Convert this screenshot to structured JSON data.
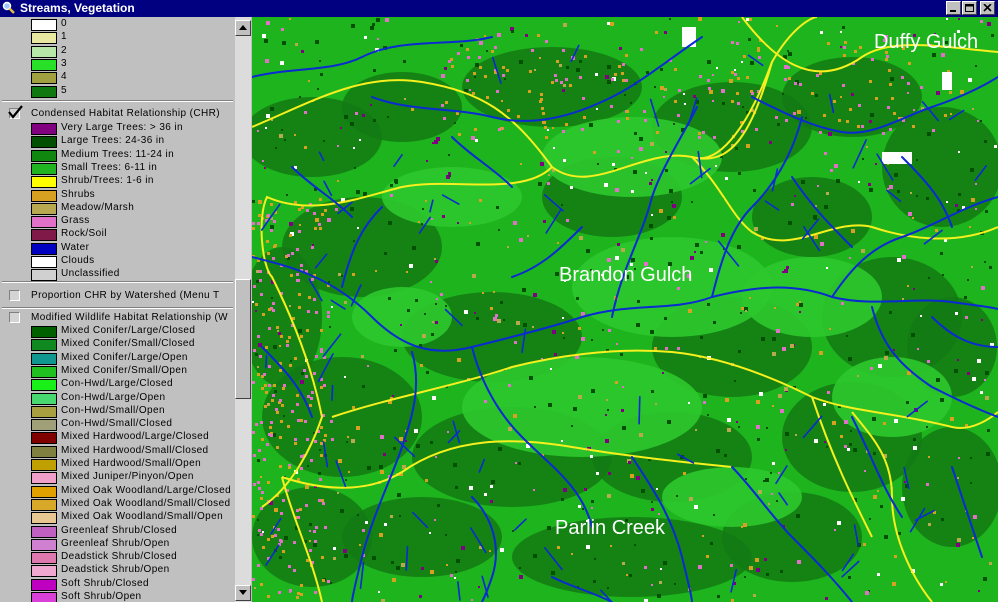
{
  "window": {
    "title": "Streams, Vegetation"
  },
  "colors": {
    "titlebar": "#000080",
    "map_base": "#1eb41e",
    "map_light": "#2cc82c",
    "map_dark": "#137a13",
    "stream": "#0a2ad2",
    "watershed_boundary": "#f5f01e"
  },
  "legend_top": [
    {
      "label": "0",
      "color": "#ffffff"
    },
    {
      "label": "1",
      "color": "#e8e8a0"
    },
    {
      "label": "2",
      "color": "#b8e8a8"
    },
    {
      "label": "3",
      "color": "#28e028"
    },
    {
      "label": "4",
      "color": "#a0a040"
    },
    {
      "label": "5",
      "color": "#107810"
    }
  ],
  "layers": {
    "chr": {
      "name": "Condensed Habitat Relationship (CHR)",
      "checked": true,
      "classes": [
        {
          "label": "Very Large Trees: > 36 in",
          "color": "#800080"
        },
        {
          "label": "Large Trees: 24-36 in",
          "color": "#005000"
        },
        {
          "label": "Medium Trees: 11-24 in",
          "color": "#108810"
        },
        {
          "label": "Small Trees: 6-11 in",
          "color": "#20b420"
        },
        {
          "label": "Shrub/Trees: 1-6 in",
          "color": "#ffff00"
        },
        {
          "label": "Shrubs",
          "color": "#d8a020"
        },
        {
          "label": "Meadow/Marsh",
          "color": "#b8a850"
        },
        {
          "label": "Grass",
          "color": "#e070c8"
        },
        {
          "label": "Rock/Soil",
          "color": "#801848"
        },
        {
          "label": "Water",
          "color": "#0000c0"
        },
        {
          "label": "Clouds",
          "color": "#ffffff"
        },
        {
          "label": "Unclassified",
          "color": "#d0d0d0"
        }
      ]
    },
    "proportion": {
      "name": "Proportion CHR by Watershed (Menu T",
      "checked": false
    },
    "mwhr": {
      "name": "Modified Wildlife Habitat Relationship (W",
      "checked": false,
      "classes": [
        {
          "label": "Mixed Conifer/Large/Closed",
          "color": "#006000"
        },
        {
          "label": "Mixed Conifer/Small/Closed",
          "color": "#108a20"
        },
        {
          "label": "Mixed Conifer/Large/Open",
          "color": "#109890"
        },
        {
          "label": "Mixed Conifer/Small/Open",
          "color": "#20c020"
        },
        {
          "label": "Con-Hwd/Large/Closed",
          "color": "#18f018"
        },
        {
          "label": "Con-Hwd/Large/Open",
          "color": "#48d870"
        },
        {
          "label": "Con-Hwd/Small/Open",
          "color": "#a8a040"
        },
        {
          "label": "Con-Hwd/Small/Closed",
          "color": "#a0a078"
        },
        {
          "label": "Mixed Hardwood/Large/Closed",
          "color": "#800000"
        },
        {
          "label": "Mixed Hardwood/Small/Closed",
          "color": "#808040"
        },
        {
          "label": "Mixed Hardwood/Small/Open",
          "color": "#c0a000"
        },
        {
          "label": "Mixed Juniper/Pinyon/Open",
          "color": "#f0a0c8"
        },
        {
          "label": "Mixed Oak Woodland/Large/Closed",
          "color": "#e0a000"
        },
        {
          "label": "Mixed Oak Woodland/Small/Closed",
          "color": "#d8a828"
        },
        {
          "label": "Mixed Oak Woodland/Small/Open",
          "color": "#e8c890"
        },
        {
          "label": "Greenleaf Shrub/Closed",
          "color": "#c060c0"
        },
        {
          "label": "Greenleaf Shrub/Open",
          "color": "#d080d0"
        },
        {
          "label": "Deadstick Shrub/Closed",
          "color": "#e078b0"
        },
        {
          "label": "Deadstick Shrub/Open",
          "color": "#f0a8d0"
        },
        {
          "label": "Soft Shrub/Closed",
          "color": "#c000c0"
        },
        {
          "label": "Soft Shrub/Open",
          "color": "#d840d8"
        }
      ]
    }
  },
  "map": {
    "labels": {
      "duffy": "Duffy Gulch",
      "brandon": "Brandon Gulch",
      "parlin": "Parlin Creek"
    }
  }
}
